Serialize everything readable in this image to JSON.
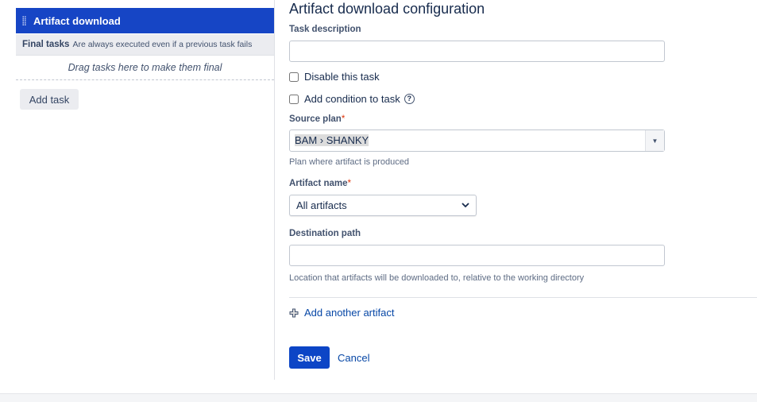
{
  "sidebar": {
    "task_name": "Artifact download",
    "final_label": "Final tasks",
    "final_desc": "Are always executed even if a previous task fails",
    "drag_hint": "Drag tasks here to make them final",
    "add_task": "Add task"
  },
  "form": {
    "title": "Artifact download configuration",
    "task_description_label": "Task description",
    "task_description_value": "",
    "disable_label": "Disable this task",
    "condition_label": "Add condition to task",
    "source_plan_label": "Source plan",
    "required_mark": "*",
    "source_plan_value": "BAM › SHANKY",
    "source_plan_help": "Plan where artifact is produced",
    "artifact_name_label": "Artifact name",
    "artifact_name_value": "All artifacts",
    "destination_label": "Destination path",
    "destination_value": "",
    "destination_help": "Location that artifacts will be downloaded to, relative to the working directory",
    "add_another": "Add another artifact",
    "save": "Save",
    "cancel": "Cancel"
  }
}
